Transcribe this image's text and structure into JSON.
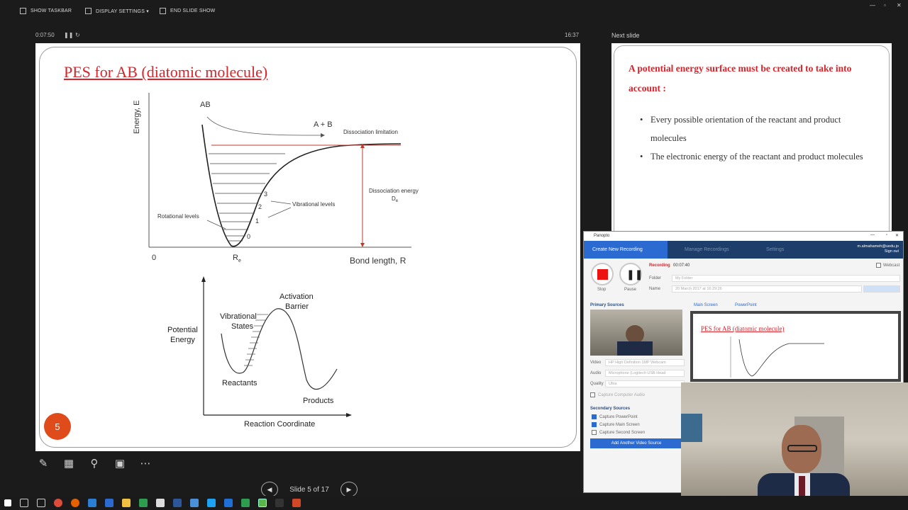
{
  "topbar": {
    "show_taskbar": "SHOW TASKBAR",
    "display_settings": "DISPLAY SETTINGS ▾",
    "end_slide_show": "END SLIDE SHOW"
  },
  "timer": {
    "elapsed": "0:07:50",
    "clock": "16:37"
  },
  "slide": {
    "title": "PES for AB (diatomic molecule)",
    "number": "5",
    "chart1": {
      "ylabel": "Energy, E",
      "xlabel": "Bond length, R",
      "origin": "0",
      "re_label": "R",
      "re_sub": "e",
      "ab": "AB",
      "apb": "A + B",
      "dissociation_limitation": "Dissociation limitation",
      "dissociation_energy": "Dissociation energy",
      "de": "D",
      "de_sub": "e",
      "rotational_levels": "Rotational levels",
      "vibrational_levels": "Vibrational levels",
      "levels": [
        "0",
        "1",
        "2",
        "3"
      ]
    },
    "chart2": {
      "ylabel_1": "Potential",
      "ylabel_2": "Energy",
      "xlabel": "Reaction Coordinate",
      "activation_1": "Activation",
      "activation_2": "Barrier",
      "vibrational_1": "Vibrational",
      "vibrational_2": "States",
      "reactants": "Reactants",
      "products": "Products"
    }
  },
  "next_slide": {
    "label": "Next slide",
    "heading": "A potential energy surface must be created to take into account :",
    "bullets": [
      "Every possible orientation of the reactant and product molecules",
      "The electronic energy of the reactant and product molecules"
    ]
  },
  "navigation": {
    "slide_counter": "Slide 5 of 17"
  },
  "panopto": {
    "window_title": "Panopto",
    "tabs": [
      "Create New Recording",
      "Manage Recordings",
      "Settings"
    ],
    "user_line1": "m.almahameh@uedu.jo",
    "user_line2": "Sign out",
    "recording_label": "Recording",
    "recording_time": "00:07:40",
    "stop": "Stop",
    "pause": "Pause",
    "folder_label": "Folder",
    "folder_value": "My Folder",
    "name_label": "Name",
    "name_value": "20 March 2017 at 16:29:26",
    "webcast": "Webcast",
    "primary_sources": "Primary Sources",
    "video_label": "Video",
    "video_value": "HP High Definition 1MP Webcam",
    "audio_label": "Audio",
    "audio_value": "Microphone (Logitech USB Head",
    "quality_label": "Quality",
    "quality_value": "Ultra",
    "capture_computer_audio": "Capture Computer Audio",
    "preview_tabs": [
      "Main Screen",
      "PowerPoint"
    ],
    "preview_title": "PES for AB (diatomic molecule)",
    "secondary_sources": "Secondary Sources",
    "secondary_items": [
      "Capture PowerPoint",
      "Capture Main Screen",
      "Capture Second Screen"
    ],
    "add_source": "Add Another Video Source"
  },
  "colors": {
    "accent_red": "#d8232a",
    "panopto_blue": "#2a6ad1",
    "badge_orange": "#e04b1b"
  }
}
